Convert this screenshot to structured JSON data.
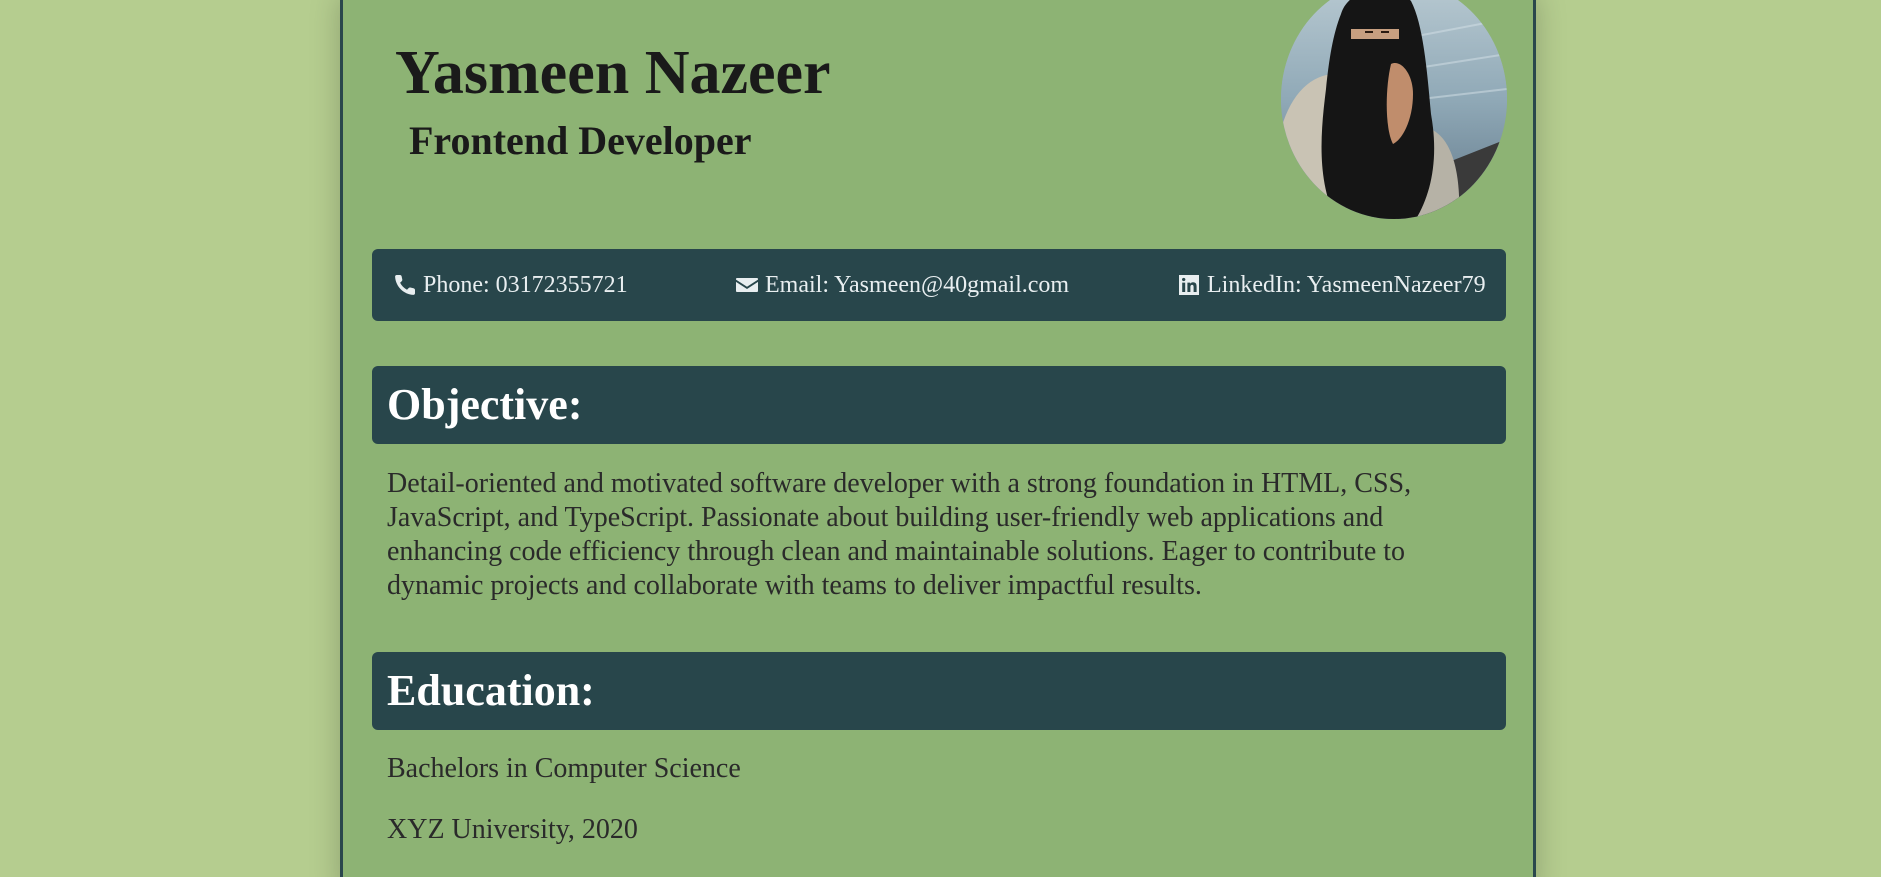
{
  "header": {
    "name": "Yasmeen Nazeer",
    "role": "Frontend Developer"
  },
  "contact": {
    "phone": "Phone: 03172355721",
    "email": "Email: Yasmeen@40gmail.com",
    "linkedin": "LinkedIn: YasmeenNazeer79"
  },
  "icons": {
    "phone": "phone-icon",
    "email": "envelope-icon",
    "linkedin": "linkedin-icon"
  },
  "sections": {
    "objective": {
      "title": "Objective:",
      "text": "Detail-oriented and motivated software developer with a strong foundation in HTML, CSS, JavaScript, and TypeScript. Passionate about building user-friendly web applications and enhancing code efficiency through clean and maintainable solutions. Eager to contribute to dynamic projects and collaborate with teams to deliver impactful results."
    },
    "education": {
      "title": "Education:",
      "degree": "Bachelors in Computer Science",
      "school": "XYZ University, 2020"
    }
  },
  "colors": {
    "page_background": "#b5cd8f",
    "card_background": "#8db374",
    "accent": "#28464b",
    "heading_text": "#ffffff",
    "body_text": "#2a2a2a"
  }
}
